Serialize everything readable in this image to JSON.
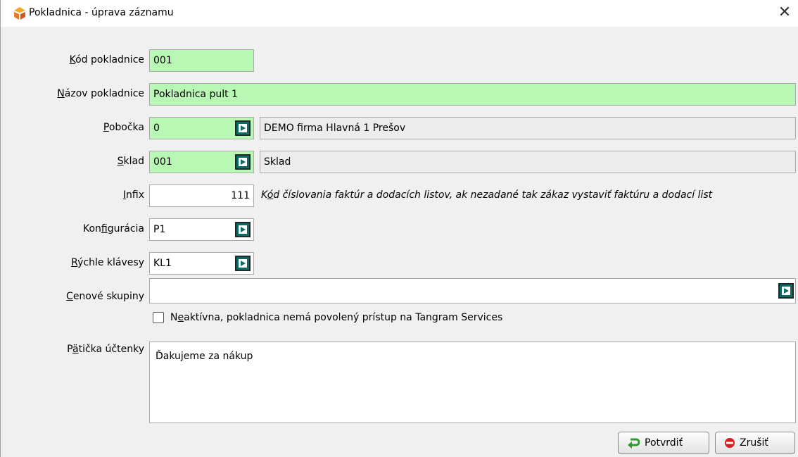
{
  "window": {
    "title": "Pokladnica - úprava záznamu",
    "close_symbol": "✕",
    "app_icon": "tangram-logo-icon"
  },
  "form": {
    "kod": {
      "label_underline": "K",
      "label_rest": "ód pokladnice",
      "value": "001"
    },
    "nazov": {
      "label_underline": "N",
      "label_rest": "ázov pokladnice",
      "value": "Pokladnica pult 1"
    },
    "pobocka": {
      "label_underline": "P",
      "label_rest": "obočka",
      "value": "0",
      "description": "DEMO firma Hlavná 1 Prešov"
    },
    "sklad": {
      "label_underline": "S",
      "label_rest": "klad",
      "value": "001",
      "description": "Sklad"
    },
    "infix": {
      "label_underline": "I",
      "label_rest": "nfix",
      "value": "111",
      "hint_prefix": "K",
      "hint_underline": "ó",
      "hint_rest": "d číslovania faktúr a dodacích listov, ak nezadané tak zákaz vystaviť faktúru a dodací list"
    },
    "konfiguracia": {
      "label_pre": "Kon",
      "label_underline": "f",
      "label_rest": "igurácia",
      "value": "P1"
    },
    "rychle": {
      "label_underline": "R",
      "label_rest": "ýchle klávesy",
      "value": "KL1"
    },
    "cenove": {
      "label_underline": "C",
      "label_rest": "enové skupiny",
      "value": ""
    },
    "neaktivna": {
      "label_pre": "N",
      "label_underline": "e",
      "label_rest": "aktívna, pokladnica nemá povolený prístup na Tangram Services",
      "checked": false
    },
    "paticka": {
      "label_pre": "P",
      "label_underline": "ä",
      "label_rest": "tička účtenky",
      "value": "Ďakujeme za nákup"
    }
  },
  "buttons": {
    "confirm": "Potvrdiť",
    "cancel": "Zrušiť"
  },
  "colors": {
    "required_field": "#b8f8b4",
    "readonly_field": "#ececec",
    "picker_button": "#0d6b64"
  }
}
